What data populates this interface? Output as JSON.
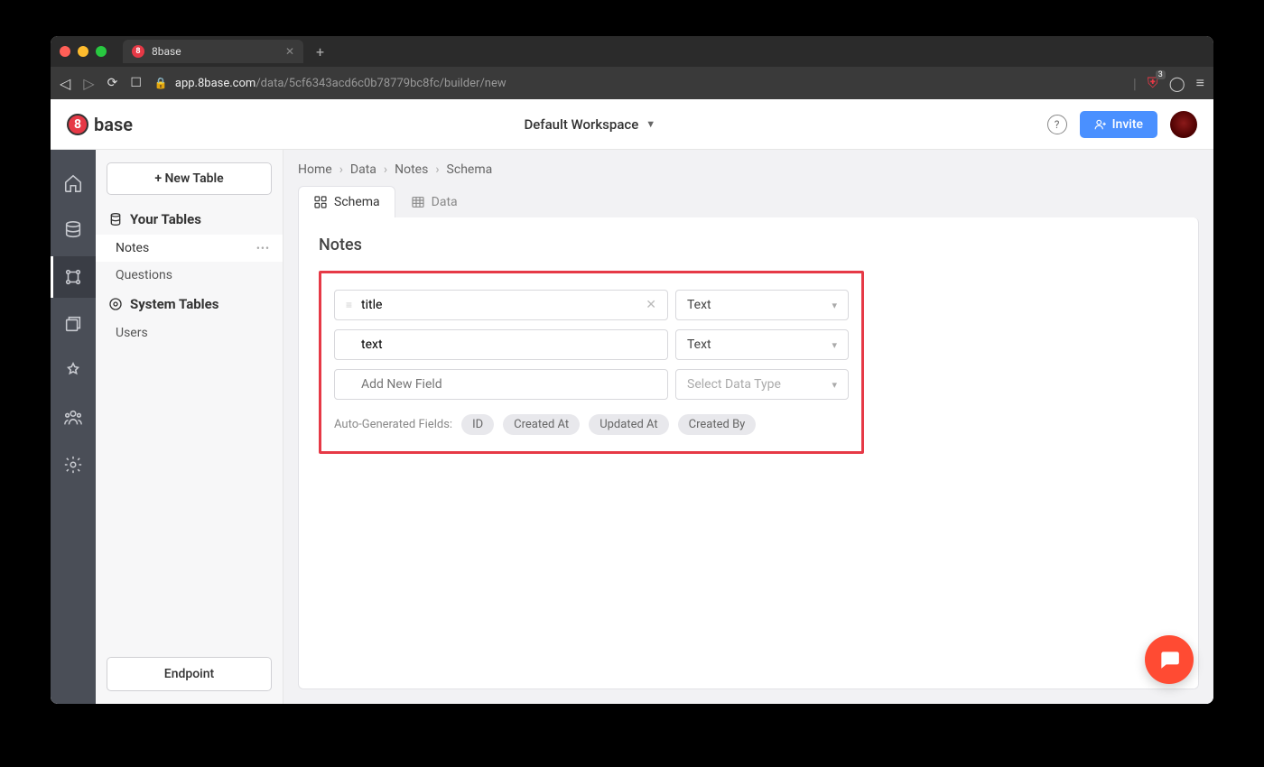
{
  "browser": {
    "tab_title": "8base",
    "url_host": "app.8base.com",
    "url_path": "/data/5cf6343acd6c0b78779bc8fc/builder/new",
    "shield_count": "3"
  },
  "header": {
    "logo_text": "base",
    "workspace": "Default Workspace",
    "invite_label": "Invite"
  },
  "side_panel": {
    "new_table_label": "+ New Table",
    "your_tables_title": "Your Tables",
    "system_tables_title": "System Tables",
    "your_tables": [
      "Notes",
      "Questions"
    ],
    "system_tables": [
      "Users"
    ],
    "active_table": "Notes",
    "endpoint_label": "Endpoint"
  },
  "breadcrumb": [
    "Home",
    "Data",
    "Notes",
    "Schema"
  ],
  "tabs": {
    "schema": "Schema",
    "data": "Data",
    "active": "schema"
  },
  "card": {
    "title": "Notes",
    "fields": [
      {
        "name": "title",
        "type": "Text"
      },
      {
        "name": "text",
        "type": "Text"
      }
    ],
    "new_field_placeholder": "Add New Field",
    "new_type_placeholder": "Select Data Type",
    "auto_gen_label": "Auto-Generated Fields:",
    "auto_gen_fields": [
      "ID",
      "Created At",
      "Updated At",
      "Created By"
    ]
  }
}
